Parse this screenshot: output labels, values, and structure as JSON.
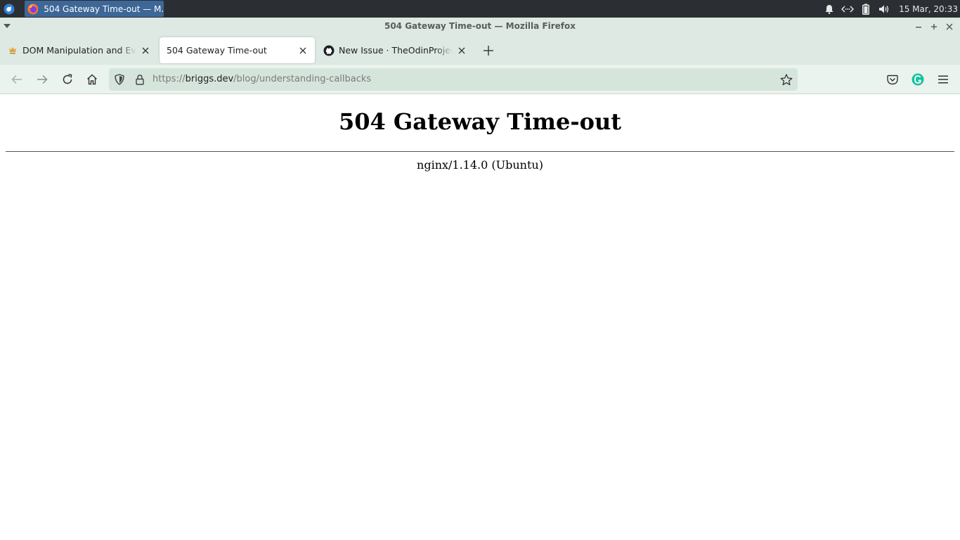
{
  "system_panel": {
    "task_title": "504 Gateway Time-out — M...",
    "clock": "15 Mar, 20:33"
  },
  "window": {
    "title": "504 Gateway Time-out — Mozilla Firefox"
  },
  "tabs": [
    {
      "label": "DOM Manipulation and Events | The Odin Project",
      "favicon": "odin-project-icon",
      "active": false
    },
    {
      "label": "504 Gateway Time-out",
      "favicon": "none",
      "active": true
    },
    {
      "label": "New Issue · TheOdinProject/curriculum",
      "favicon": "github-icon",
      "active": false
    }
  ],
  "navbar": {
    "url_host": "briggs.dev",
    "url_prefix": "https://",
    "url_path": "/blog/understanding-callbacks"
  },
  "page": {
    "heading": "504 Gateway Time-out",
    "server": "nginx/1.14.0 (Ubuntu)"
  },
  "colors": {
    "panel_bg": "#2b2e33",
    "task_active": "#3d6797",
    "chrome_bg": "#dde9e2",
    "toolbar_bg": "#eaf3ee",
    "urlbar_bg": "#d5e5dc",
    "grammarly": "#15c39a"
  }
}
